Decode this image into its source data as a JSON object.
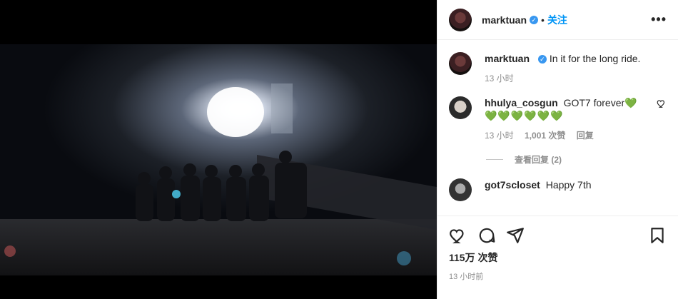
{
  "header": {
    "username": "marktuan",
    "verified_mark": "✓",
    "separator": "•",
    "follow_label": "关注",
    "more_label": "•••"
  },
  "caption": {
    "username": "marktuan",
    "text": "In it for the long ride.",
    "time": "13 小时"
  },
  "comments": [
    {
      "username": "hhulya_cosgun",
      "text": "GOT7 forever💚",
      "emojis": "💚💚💚💚💚💚",
      "time": "13 小时",
      "likes": "1,001 次赞",
      "reply": "回复",
      "view_replies": "查看回复 (2)"
    },
    {
      "username": "got7scloset",
      "text": "Happy 7th"
    }
  ],
  "footer": {
    "likes": "115万 次赞",
    "time": "13 小时前"
  },
  "colors": {
    "accent": "#0095f6",
    "verified": "#3897f0",
    "heart_emoji": "#22c55e"
  },
  "icons": [
    "like-icon",
    "comment-icon",
    "share-icon",
    "save-icon",
    "small-heart-icon"
  ]
}
